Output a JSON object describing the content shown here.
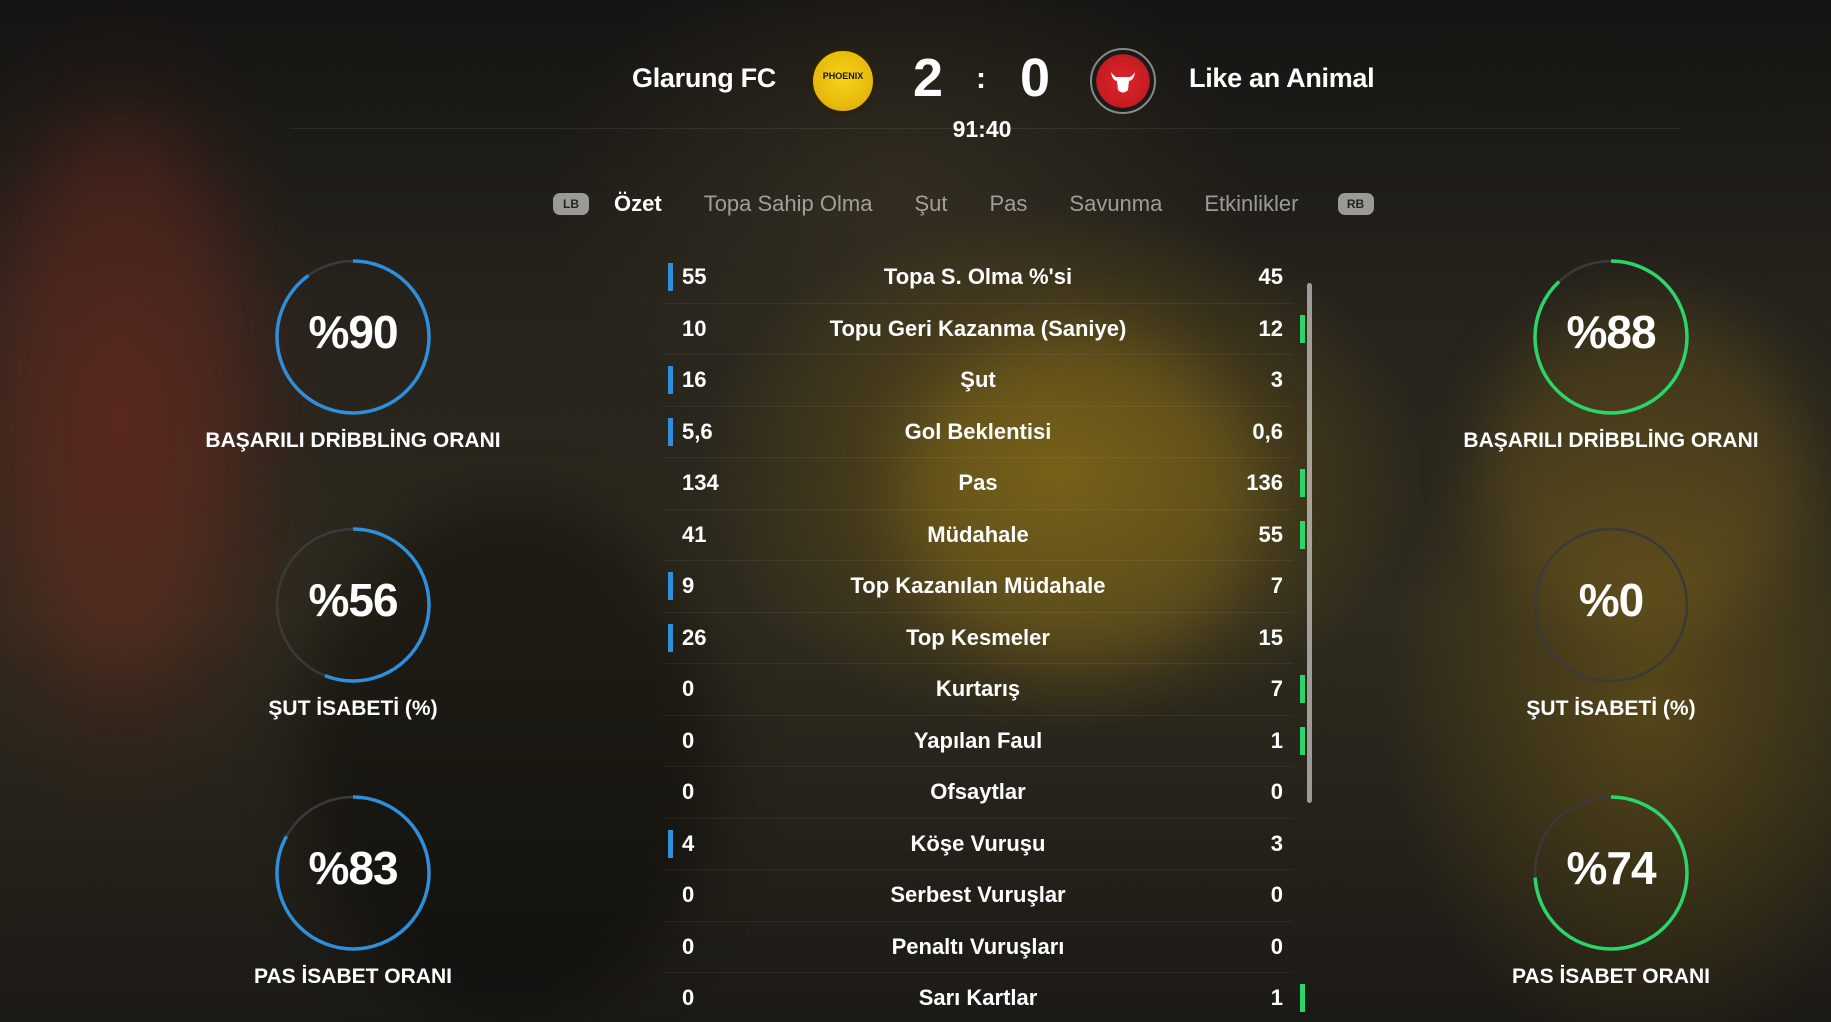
{
  "match": {
    "home_team": "Glarung FC",
    "away_team": "Like an Animal",
    "home_crest_text": "PHOENIX",
    "home_score": "2",
    "separator": ":",
    "away_score": "0",
    "clock": "91:40"
  },
  "tabs": {
    "left_bumper": "LB",
    "right_bumper": "RB",
    "items": [
      "Özet",
      "Topa Sahip Olma",
      "Şut",
      "Pas",
      "Savunma",
      "Etkinlikler"
    ],
    "active": "Özet"
  },
  "stats": [
    {
      "label": "Topa S. Olma %'si",
      "home": "55",
      "away": "45",
      "leader": "home"
    },
    {
      "label": "Topu Geri Kazanma (Saniye)",
      "home": "10",
      "away": "12",
      "leader": "away"
    },
    {
      "label": "Şut",
      "home": "16",
      "away": "3",
      "leader": "home"
    },
    {
      "label": "Gol Beklentisi",
      "home": "5,6",
      "away": "0,6",
      "leader": "home"
    },
    {
      "label": "Pas",
      "home": "134",
      "away": "136",
      "leader": "away"
    },
    {
      "label": "Müdahale",
      "home": "41",
      "away": "55",
      "leader": "away"
    },
    {
      "label": "Top Kazanılan Müdahale",
      "home": "9",
      "away": "7",
      "leader": "home"
    },
    {
      "label": "Top Kesmeler",
      "home": "26",
      "away": "15",
      "leader": "home"
    },
    {
      "label": "Kurtarış",
      "home": "0",
      "away": "7",
      "leader": "away"
    },
    {
      "label": "Yapılan Faul",
      "home": "0",
      "away": "1",
      "leader": "away"
    },
    {
      "label": "Ofsaytlar",
      "home": "0",
      "away": "0",
      "leader": "none"
    },
    {
      "label": "Köşe Vuruşu",
      "home": "4",
      "away": "3",
      "leader": "home"
    },
    {
      "label": "Serbest Vuruşlar",
      "home": "0",
      "away": "0",
      "leader": "none"
    },
    {
      "label": "Penaltı Vuruşları",
      "home": "0",
      "away": "0",
      "leader": "none"
    },
    {
      "label": "Sarı Kartlar",
      "home": "0",
      "away": "1",
      "leader": "away"
    }
  ],
  "gauges": {
    "home": [
      {
        "text": "%90",
        "value": 0.9,
        "label": "BAŞARILI DRİBBLİNG ORANI"
      },
      {
        "text": "%56",
        "value": 0.56,
        "label": "ŞUT İSABETİ (%)"
      },
      {
        "text": "%83",
        "value": 0.83,
        "label": "PAS İSABET ORANI"
      }
    ],
    "away": [
      {
        "text": "%88",
        "value": 0.88,
        "label": "BAŞARILI DRİBBLİNG ORANI"
      },
      {
        "text": "%0",
        "value": 0.0,
        "label": "ŞUT İSABETİ (%)"
      },
      {
        "text": "%74",
        "value": 0.74,
        "label": "PAS İSABET ORANI"
      }
    ]
  },
  "colors": {
    "home": "#2e8fdc",
    "away": "#2ad66a",
    "track": "#3a3a3a"
  }
}
